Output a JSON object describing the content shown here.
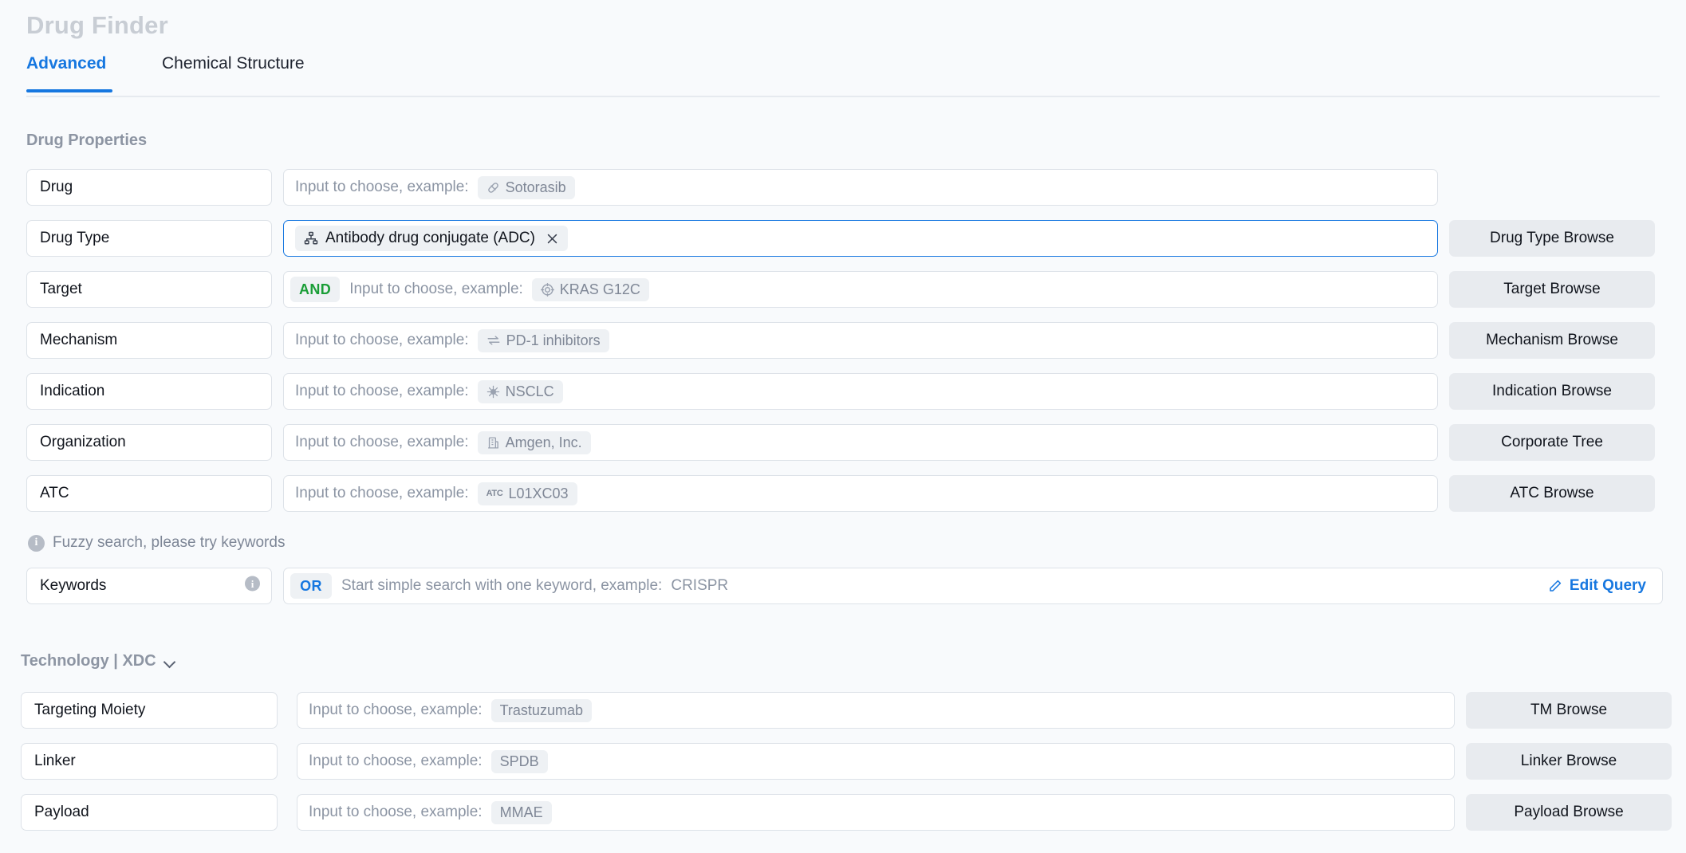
{
  "header": {
    "title": "Drug Finder",
    "tabs": [
      {
        "label": "Advanced",
        "active": true
      },
      {
        "label": "Chemical Structure",
        "active": false
      }
    ]
  },
  "sections": {
    "drug_properties": {
      "title": "Drug Properties"
    },
    "technology": {
      "title": "Technology | XDC",
      "expand_icon": "chevron-down-icon"
    }
  },
  "placeholders": {
    "input_to_choose": "Input to choose, example:",
    "simple_search": "Start simple search with one keyword, example:"
  },
  "rows": {
    "drug": {
      "label": "Drug",
      "placeholder": "Input to choose, example:",
      "example": "Sotorasib",
      "example_icon": "capsule-icon",
      "browse": null,
      "operator": null,
      "focused": false
    },
    "drug_type": {
      "label": "Drug Type",
      "selected_tag": "Antibody drug conjugate (ADC)",
      "selected_tag_icon": "hierarchy-icon",
      "close_icon": "close-icon",
      "browse": "Drug Type Browse",
      "operator": null,
      "focused": true
    },
    "target": {
      "label": "Target",
      "placeholder": "Input to choose, example:",
      "example": "KRAS G12C",
      "example_icon": "target-icon",
      "browse": "Target Browse",
      "operator": "AND",
      "focused": false
    },
    "mechanism": {
      "label": "Mechanism",
      "placeholder": "Input to choose, example:",
      "example": "PD-1 inhibitors",
      "example_icon": "equilibrium-arrows-icon",
      "browse": "Mechanism Browse",
      "operator": null,
      "focused": false
    },
    "indication": {
      "label": "Indication",
      "placeholder": "Input to choose, example:",
      "example": "NSCLC",
      "example_icon": "virus-icon",
      "browse": "Indication Browse",
      "operator": null,
      "focused": false
    },
    "organization": {
      "label": "Organization",
      "placeholder": "Input to choose, example:",
      "example": "Amgen, Inc.",
      "example_icon": "building-icon",
      "browse": "Corporate Tree",
      "operator": null,
      "focused": false
    },
    "atc": {
      "label": "ATC",
      "placeholder": "Input to choose, example:",
      "example": "L01XC03",
      "example_icon": "atc-icon",
      "browse": "ATC Browse",
      "operator": null,
      "focused": false
    },
    "keywords": {
      "label": "Keywords",
      "label_icon": "info-icon",
      "placeholder": "Start simple search with one keyword, example:",
      "example": "CRISPR",
      "example_icon": null,
      "operator": "OR",
      "edit_query": "Edit Query",
      "edit_query_icon": "pencil-icon",
      "focused": false
    },
    "targeting_moiety": {
      "label": "Targeting Moiety",
      "placeholder": "Input to choose, example:",
      "example": "Trastuzumab",
      "example_icon": null,
      "browse": "TM Browse",
      "operator": null,
      "focused": false
    },
    "linker": {
      "label": "Linker",
      "placeholder": "Input to choose, example:",
      "example": "SPDB",
      "example_icon": null,
      "browse": "Linker Browse",
      "operator": null,
      "focused": false
    },
    "payload": {
      "label": "Payload",
      "placeholder": "Input to choose, example:",
      "example": "MMAE",
      "example_icon": null,
      "browse": "Payload Browse",
      "operator": null,
      "focused": false
    }
  },
  "hints": {
    "fuzzy_search": "Fuzzy search, please try keywords",
    "fuzzy_icon": "info-icon"
  },
  "colors": {
    "accent_blue": "#1677e0",
    "and_green": "#1a9e37",
    "page_bg": "#f8fafc",
    "field_border": "#dde2e8",
    "chip_bg": "#eef1f4",
    "browse_bg": "#e8ebef",
    "title_gray": "#c8cdd4"
  }
}
